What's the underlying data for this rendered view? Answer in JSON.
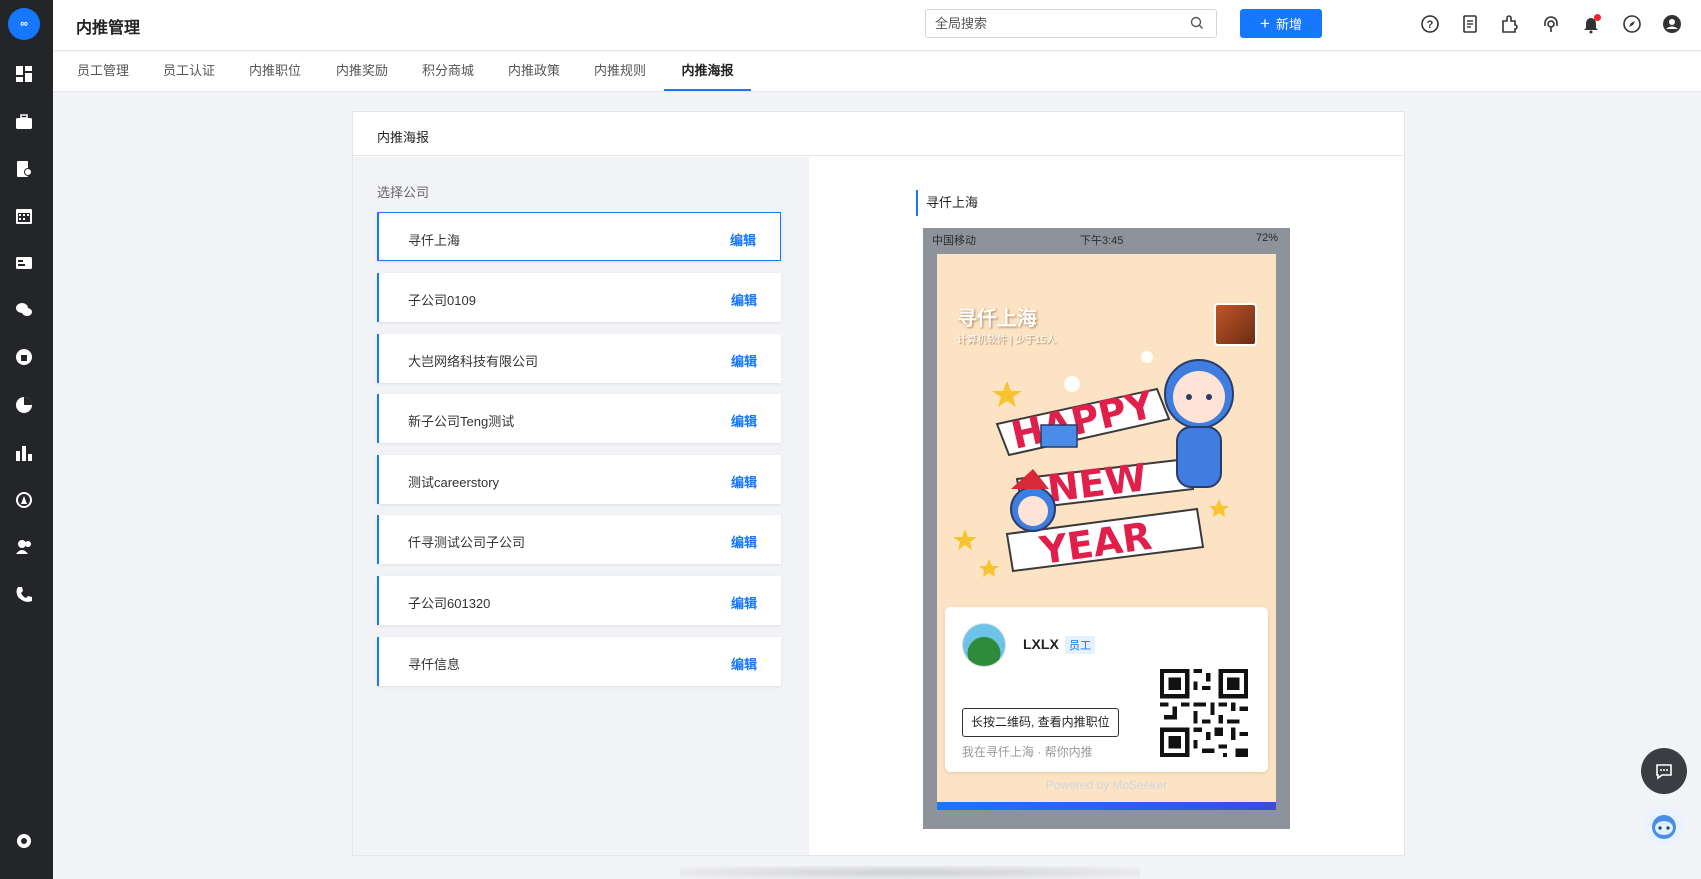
{
  "sidebar": {
    "logo_text": "∞",
    "items": [
      {
        "icon": "dashboard-icon"
      },
      {
        "icon": "briefcase-icon"
      },
      {
        "icon": "resume-icon"
      },
      {
        "icon": "calendar-icon"
      },
      {
        "icon": "id-card-icon"
      },
      {
        "icon": "wechat-icon"
      },
      {
        "icon": "thumbs-up-icon"
      },
      {
        "icon": "pie-chart-icon"
      },
      {
        "icon": "bar-chart-icon"
      },
      {
        "icon": "a-badge-icon"
      },
      {
        "icon": "users-icon"
      },
      {
        "icon": "phone-icon"
      }
    ],
    "settings_icon": "settings-icon"
  },
  "header": {
    "title": "内推管理",
    "search_placeholder": "全局搜索",
    "add_label": "新增",
    "accent": "#1677ff"
  },
  "tabs": [
    {
      "label": "员工管理",
      "active": false
    },
    {
      "label": "员工认证",
      "active": false
    },
    {
      "label": "内推职位",
      "active": false
    },
    {
      "label": "内推奖励",
      "active": false
    },
    {
      "label": "积分商城",
      "active": false
    },
    {
      "label": "内推政策",
      "active": false
    },
    {
      "label": "内推规则",
      "active": false
    },
    {
      "label": "内推海报",
      "active": true
    }
  ],
  "panel": {
    "title": "内推海报",
    "select_label": "选择公司",
    "edit_label": "编辑",
    "companies": [
      {
        "name": "寻仟上海",
        "selected": true
      },
      {
        "name": "子公司0109",
        "selected": false
      },
      {
        "name": "大岂网络科技有限公司",
        "selected": false
      },
      {
        "name": "新子公司Teng测试",
        "selected": false
      },
      {
        "name": "测试careerstory",
        "selected": false
      },
      {
        "name": "仟寻测试公司子公司",
        "selected": false
      },
      {
        "name": "子公司601320",
        "selected": false
      },
      {
        "name": "寻仟信息",
        "selected": false
      }
    ]
  },
  "preview": {
    "title": "寻仟上海",
    "status": {
      "carrier": "中国移动",
      "time": "下午3:45",
      "battery": "72%"
    },
    "poster": {
      "company": "寻仟上海",
      "meta": "计算机软件 | 少于15人",
      "art_lines": [
        "HAPPY",
        "NEW",
        "YEAR"
      ],
      "user_name": "LXLX",
      "role": "员工",
      "qr_hint": "长按二维码, 查看内推职位",
      "qr_sub": "我在寻仟上海 · 帮你内推",
      "powered": "Powered by MoSeeker"
    }
  }
}
